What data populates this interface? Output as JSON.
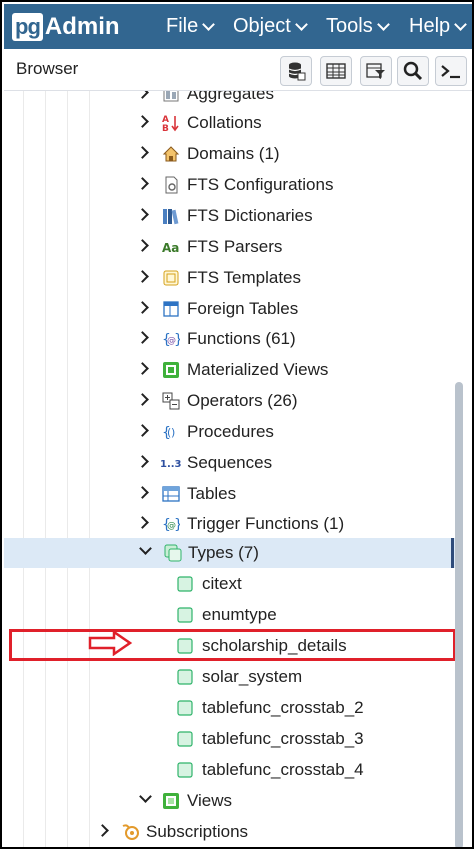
{
  "app": {
    "logo_pg": "pg",
    "logo_admin": "Admin"
  },
  "menu": [
    {
      "label": "File"
    },
    {
      "label": "Object"
    },
    {
      "label": "Tools"
    },
    {
      "label": "Help"
    }
  ],
  "browser": {
    "title": "Browser"
  },
  "toolbar": {
    "buttons": [
      "database-query-icon",
      "table-view-icon",
      "filter-rows-icon",
      "search-icon",
      "terminal-icon"
    ]
  },
  "tree": {
    "items": [
      {
        "label": "Aggregates",
        "icon": "aggregates-icon",
        "state": "collapsed"
      },
      {
        "label": "Collations",
        "icon": "collations-icon",
        "state": "collapsed"
      },
      {
        "label": "Domains (1)",
        "icon": "domains-icon",
        "state": "collapsed"
      },
      {
        "label": "FTS Configurations",
        "icon": "fts-configurations-icon",
        "state": "collapsed"
      },
      {
        "label": "FTS Dictionaries",
        "icon": "fts-dictionaries-icon",
        "state": "collapsed"
      },
      {
        "label": "FTS Parsers",
        "icon": "fts-parsers-icon",
        "state": "collapsed"
      },
      {
        "label": "FTS Templates",
        "icon": "fts-templates-icon",
        "state": "collapsed"
      },
      {
        "label": "Foreign Tables",
        "icon": "foreign-tables-icon",
        "state": "collapsed"
      },
      {
        "label": "Functions (61)",
        "icon": "functions-icon",
        "state": "collapsed"
      },
      {
        "label": "Materialized Views",
        "icon": "materialized-views-icon",
        "state": "collapsed"
      },
      {
        "label": "Operators (26)",
        "icon": "operators-icon",
        "state": "collapsed"
      },
      {
        "label": "Procedures",
        "icon": "procedures-icon",
        "state": "collapsed"
      },
      {
        "label": "Sequences",
        "icon": "sequences-icon",
        "state": "collapsed"
      },
      {
        "label": "Tables",
        "icon": "tables-icon",
        "state": "collapsed"
      },
      {
        "label": "Trigger Functions (1)",
        "icon": "trigger-functions-icon",
        "state": "collapsed"
      },
      {
        "label": "Types (7)",
        "icon": "types-icon",
        "state": "expanded",
        "selected": true
      },
      {
        "label": "citext",
        "icon": "type-icon",
        "state": "leaf"
      },
      {
        "label": "enumtype",
        "icon": "type-icon",
        "state": "leaf"
      },
      {
        "label": "scholarship_details",
        "icon": "type-icon",
        "state": "leaf",
        "highlighted": true
      },
      {
        "label": "solar_system",
        "icon": "type-icon",
        "state": "leaf"
      },
      {
        "label": "tablefunc_crosstab_2",
        "icon": "type-icon",
        "state": "leaf"
      },
      {
        "label": "tablefunc_crosstab_3",
        "icon": "type-icon",
        "state": "leaf"
      },
      {
        "label": "tablefunc_crosstab_4",
        "icon": "type-icon",
        "state": "leaf"
      },
      {
        "label": "Views",
        "icon": "views-icon",
        "state": "expanded"
      },
      {
        "label": "Subscriptions",
        "icon": "subscriptions-icon",
        "state": "collapsed"
      }
    ]
  },
  "colors": {
    "navbar": "#326690",
    "selected_row": "#dce9f6",
    "annotation_red": "#e0202a",
    "type_icon_green": "#2fb36a"
  }
}
